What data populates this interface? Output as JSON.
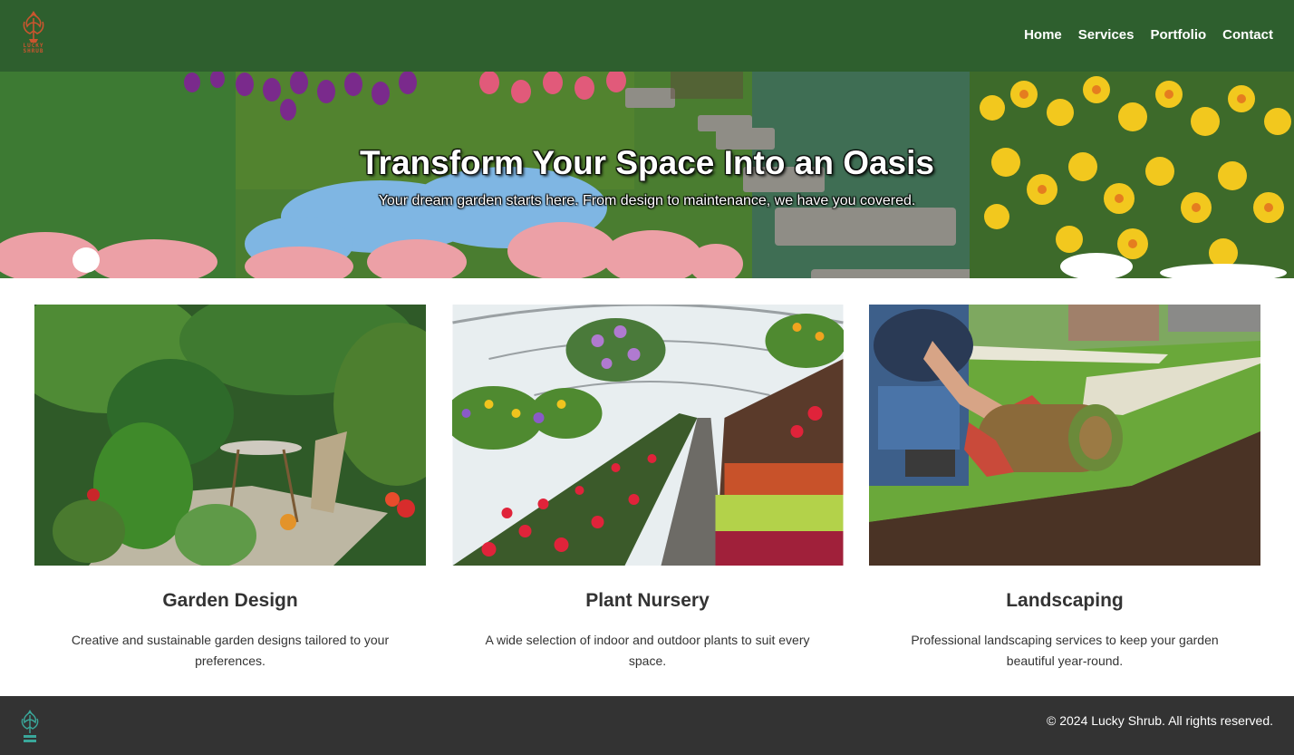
{
  "brand": {
    "logo_text_line1": "LUCKY",
    "logo_text_line2": "SHRUB"
  },
  "nav": {
    "items": [
      {
        "label": "Home"
      },
      {
        "label": "Services"
      },
      {
        "label": "Portfolio"
      },
      {
        "label": "Contact"
      }
    ]
  },
  "hero": {
    "title": "Transform Your Space Into an Oasis",
    "subtitle": "Your dream garden starts here. From design to maintenance, we have you covered."
  },
  "services": [
    {
      "title": "Garden Design",
      "text": "Creative and sustainable garden designs tailored to your preferences."
    },
    {
      "title": "Plant Nursery",
      "text": "A wide selection of indoor and outdoor plants to suit every space."
    },
    {
      "title": "Landscaping",
      "text": "Professional landscaping services to keep your garden beautiful year-round."
    }
  ],
  "footer": {
    "copyright": "© 2024 Lucky Shrub. All rights reserved."
  },
  "colors": {
    "header": "#2e5f2e",
    "footer": "#333333",
    "logo": "#c9552e",
    "footer_logo": "#3aa79a"
  }
}
